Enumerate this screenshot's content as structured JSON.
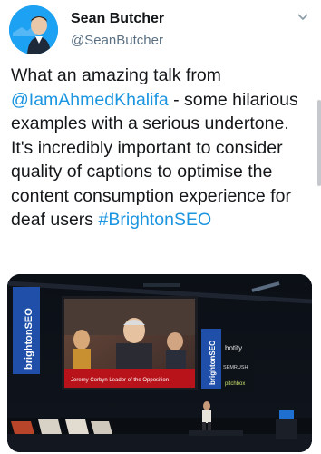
{
  "user": {
    "name": "Sean Butcher",
    "handle": "@SeanButcher"
  },
  "tweet": {
    "part1": "What an amazing talk from ",
    "mention": "@IamAhmedKhalifa",
    "part2": " - some hilarious examples with a serious undertone. It's incredibly important to consider quality of captions to optimise the content consumption experience for deaf users ",
    "hashtag": "#BrightonSEO"
  },
  "media": {
    "banner_left": "brightonSEO",
    "banner_right": "brightonSEO",
    "sponsors": [
      "botify",
      "SEMRUSH",
      "pitchbox"
    ],
    "caption": "Jeremy Corbyn Leader of the Opposition"
  },
  "icons": {
    "caret": "chevron-down-icon"
  },
  "colors": {
    "link": "#1b95e0",
    "avatar_bg": "#1da1f2"
  }
}
